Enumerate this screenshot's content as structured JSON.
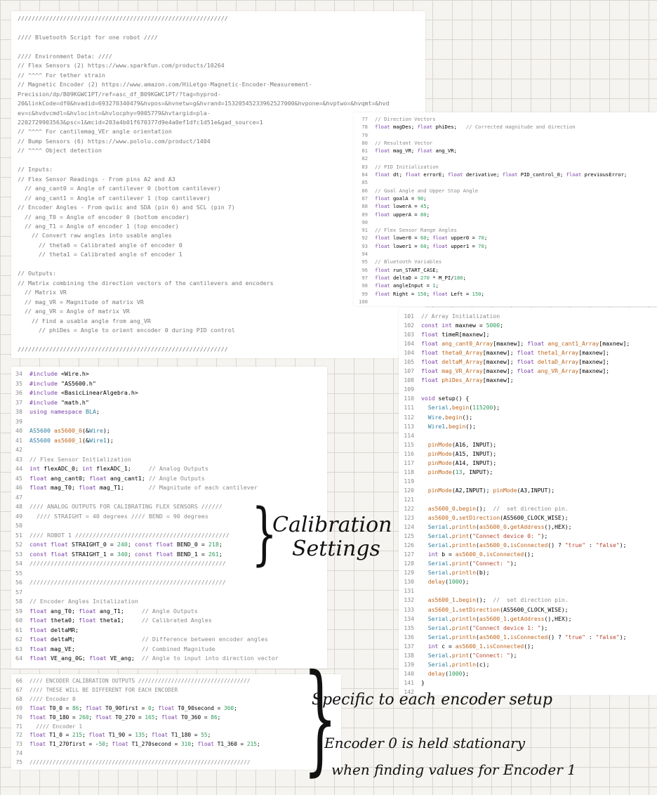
{
  "header_panel": {
    "lines": [
      "////////////////////////////////////////////////////////////",
      "",
      "//// Bluetooth Script for one robot ////",
      "",
      "//// Environment Data: ////",
      "// Flex Sensors (2) https://www.sparkfun.com/products/10264",
      "// ^^^^ For tether strain",
      "// Magnetic Encoder (2) https://www.amazon.com/HiLetgo-Magnetic-Encoder-Measurement-",
      "Precision/dp/B09KGWC1PT/ref=asc_df_B09KGWC1PT/?tag=hyprod-",
      "20&linkCode=df0&hvadid=693270340479&hvpos=&hvnetw=g&hvrand=15320545233962527000&hvpone=&hvptwo=&hvqmt=&hvd",
      "ev=c&hvdvcmdl=&hvlocint=&hvlocphy=9005779&hvtargid=pla-",
      "2202729903563&psc=1&mcid=203a4b01f670377d9e4a0ef1dfc1d51e&gad_source=1",
      "// ^^^^ For cantilemag_VEr angle orientation",
      "// Bump Sensors (6) https://www.pololu.com/product/1404",
      "// ^^^^ Object detection",
      "",
      "// Inputs:",
      "// Flex Sensor Readings - From pins A2 and A3",
      "  // ang_cant0 = Angle of cantilever 0 (bottom cantilever)",
      "  // ang_cant1 = Angle of cantilever 1 (top cantilever)",
      "// Encoder Angles - From qwiic and SDA (pin 6) and SCL (pin 7)",
      "  // ang_T0 = Angle of encoder 0 (bottom encoder)",
      "  // ang_T1 = Angle of encoder 1 (top encoder)",
      "    // Convert raw angles into usable angles",
      "      // theta0 = Calibrated angle of encoder 0",
      "      // theta1 = Calibrated angle of encoder 1",
      "",
      "// Outputs:",
      "// Matrix combining the direction vectors of the cantilevers and encoders",
      "  // Matrix VR",
      "  // mag_VR = Magnitude of matrix VR",
      "  // ang_VR = Angle of matrix VR",
      "    // Find a usable angle from ang_VR",
      "      // phiDes = Angle to orient encoder 0 during PID control",
      "",
      "////////////////////////////////////////////////////////////"
    ]
  },
  "panel_a": {
    "lines": [
      {
        "n": "77",
        "t": "// Direction Vectors"
      },
      {
        "n": "78",
        "t": "float magDes; float phiDes;   // Corrected magnitude and direction"
      },
      {
        "n": "79",
        "t": ""
      },
      {
        "n": "80",
        "t": "// Resultant Vector"
      },
      {
        "n": "81",
        "t": "float mag_VR; float ang_VR;"
      },
      {
        "n": "82",
        "t": ""
      },
      {
        "n": "83",
        "t": "// PID Initialization"
      },
      {
        "n": "84",
        "t": "float dt; float errorE; float derivative; float PID_control_0; float previousError;"
      },
      {
        "n": "85",
        "t": ""
      },
      {
        "n": "86",
        "t": "// Goal Angle and Upper Stop Angle"
      },
      {
        "n": "87",
        "t": "float goalA = 90;"
      },
      {
        "n": "88",
        "t": "float lowerA = 45;"
      },
      {
        "n": "89",
        "t": "float upperA = 80;"
      },
      {
        "n": "90",
        "t": ""
      },
      {
        "n": "91",
        "t": "// Flex Sensor Range Angles"
      },
      {
        "n": "92",
        "t": "float lower0 = 60; float upper0 = 70;"
      },
      {
        "n": "93",
        "t": "float lower1 = 60; float upper1 = 70;"
      },
      {
        "n": "94",
        "t": ""
      },
      {
        "n": "95",
        "t": "// Bluetooth Variables"
      },
      {
        "n": "96",
        "t": "float run_START_CASE;"
      },
      {
        "n": "97",
        "t": "float deltaD = 270 * M_PI/180;"
      },
      {
        "n": "98",
        "t": "float angleInput = 1;"
      },
      {
        "n": "99",
        "t": "float Right = 150; float Left = 150;"
      },
      {
        "n": "100",
        "t": ""
      }
    ]
  },
  "panel_b": {
    "lines": [
      {
        "n": "101",
        "t": "// Array Initialization"
      },
      {
        "n": "102",
        "t": "const int maxnew = 5000;"
      },
      {
        "n": "103",
        "t": "float timeR[maxnew];"
      },
      {
        "n": "104",
        "t": "float ang_cant0_Array[maxnew]; float ang_cant1_Array[maxnew];"
      },
      {
        "n": "104",
        "t": "float theta0_Array[maxnew]; float theta1_Array[maxnew];"
      },
      {
        "n": "105",
        "t": "float deltaM_Array[maxnew]; float deltaD_Array[maxnew];"
      },
      {
        "n": "107",
        "t": "float mag_VR_Array[maxnew]; float ang_VR_Array[maxnew];"
      },
      {
        "n": "108",
        "t": "float phiDes_Array[maxnew];"
      },
      {
        "n": "109",
        "t": ""
      },
      {
        "n": "110",
        "t": "void setup() {"
      },
      {
        "n": "111",
        "t": "  Serial.begin(115200);"
      },
      {
        "n": "112",
        "t": "  Wire.begin();"
      },
      {
        "n": "113",
        "t": "  Wire1.begin();"
      },
      {
        "n": "114",
        "t": ""
      },
      {
        "n": "115",
        "t": "  pinMode(A16, INPUT);"
      },
      {
        "n": "116",
        "t": "  pinMode(A15, INPUT);"
      },
      {
        "n": "117",
        "t": "  pinMode(A14, INPUT);"
      },
      {
        "n": "118",
        "t": "  pinMode(13, INPUT);"
      },
      {
        "n": "119",
        "t": ""
      },
      {
        "n": "120",
        "t": "  pinMode(A2,INPUT); pinMode(A3,INPUT);"
      },
      {
        "n": "121",
        "t": ""
      },
      {
        "n": "122",
        "t": "  as5600_0.begin();  //  set direction pin."
      },
      {
        "n": "123",
        "t": "  as5600_0.setDirection(AS5600_CLOCK_WISE);"
      },
      {
        "n": "124",
        "t": "  Serial.println(as5600_0.getAddress(),HEX);"
      },
      {
        "n": "125",
        "t": "  Serial.print(\"Connect device 0: \");"
      },
      {
        "n": "126",
        "t": "  Serial.println(as5600_0.isConnected() ? \"true\" : \"false\");"
      },
      {
        "n": "127",
        "t": "  int b = as5600_0.isConnected();"
      },
      {
        "n": "128",
        "t": "  Serial.print(\"Connect: \");"
      },
      {
        "n": "129",
        "t": "  Serial.println(b);"
      },
      {
        "n": "130",
        "t": "  delay(1000);"
      },
      {
        "n": "131",
        "t": ""
      },
      {
        "n": "132",
        "t": "  as5600_1.begin();  //  set direction pin."
      },
      {
        "n": "133",
        "t": "  as5600_1.setDirection(AS5600_CLOCK_WISE);"
      },
      {
        "n": "134",
        "t": "  Serial.println(as5600_1.getAddress(),HEX);"
      },
      {
        "n": "135",
        "t": "  Serial.print(\"Connect device 1: \");"
      },
      {
        "n": "136",
        "t": "  Serial.println(as5600_1.isConnected() ? \"true\" : \"false\");"
      },
      {
        "n": "137",
        "t": "  int c = as5600_1.isConnected();"
      },
      {
        "n": "138",
        "t": "  Serial.print(\"Connect: \");"
      },
      {
        "n": "139",
        "t": "  Serial.println(c);"
      },
      {
        "n": "140",
        "t": "  delay(1000);"
      },
      {
        "n": "141",
        "t": "}"
      },
      {
        "n": "142",
        "t": ""
      }
    ]
  },
  "panel_c": {
    "lines": [
      {
        "n": "34",
        "t": "#include <Wire.h>"
      },
      {
        "n": "35",
        "t": "#include \"AS5600.h\""
      },
      {
        "n": "36",
        "t": "#include <BasicLinearAlgebra.h>"
      },
      {
        "n": "37",
        "t": "#include \"math.h\""
      },
      {
        "n": "38",
        "t": "using namespace BLA;"
      },
      {
        "n": "39",
        "t": ""
      },
      {
        "n": "40",
        "t": "AS5600 as5600_0(&Wire);"
      },
      {
        "n": "41",
        "t": "AS5600 as5600_1(&Wire1);"
      },
      {
        "n": "42",
        "t": ""
      },
      {
        "n": "43",
        "t": "// Flex Sensor Initialization"
      },
      {
        "n": "44",
        "t": "int flexADC_0; int flexADC_1;     // Analog Outputs"
      },
      {
        "n": "45",
        "t": "float ang_cant0; float ang_cant1; // Angle Outputs"
      },
      {
        "n": "46",
        "t": "float mag_T0; float mag_T1;       // Magnitude of each cantilever"
      },
      {
        "n": "47",
        "t": ""
      },
      {
        "n": "48",
        "t": "//// ANALOG OUTPUTS FOR CALIBRATING FLEX SENSORS //////"
      },
      {
        "n": "49",
        "t": "  //// STRAIGHT = 40 degrees //// BEND = 90 degrees"
      },
      {
        "n": "50",
        "t": ""
      },
      {
        "n": "51",
        "t": "//// ROBOT 1 ////////////////////////////////////////////"
      },
      {
        "n": "52",
        "t": "const float STRAIGHT_0 = 240; const float BEND_0 = 218;"
      },
      {
        "n": "53",
        "t": "const float STRAIGHT_1 = 340; const float BEND_1 = 261;"
      },
      {
        "n": "54",
        "t": "////////////////////////////////////////////////////////"
      },
      {
        "n": "55",
        "t": ""
      },
      {
        "n": "56",
        "t": "////////////////////////////////////////////////////////"
      },
      {
        "n": "57",
        "t": ""
      },
      {
        "n": "58",
        "t": "// Encoder Angles Initalization"
      },
      {
        "n": "59",
        "t": "float ang_T0; float ang_T1;     // Angle Outputs"
      },
      {
        "n": "60",
        "t": "float theta0; float theta1;     // Calibrated Angles"
      },
      {
        "n": "61",
        "t": "float deltaMR;"
      },
      {
        "n": "62",
        "t": "float deltaM;                   // Difference between encoder angles"
      },
      {
        "n": "63",
        "t": "float mag_VE;                   // Combined Magnitude"
      },
      {
        "n": "64",
        "t": "float VE_ang_0G; float VE_ang;  // Angle to input into direction vector"
      }
    ]
  },
  "panel_d": {
    "lines": [
      {
        "n": "66",
        "t": "//// ENCODER CALIBRATION OUTPUTS //////////////////////////////////"
      },
      {
        "n": "67",
        "t": "//// THESE WILL BE DIFFERENT FOR EACH ENCODER"
      },
      {
        "n": "68",
        "t": "//// Encoder 0"
      },
      {
        "n": "69",
        "t": "float T0_0 = 86; float T0_90first = 0; float T0_90second = 360;"
      },
      {
        "n": "70",
        "t": "float T0_180 = 260; float T0_270 = 165; float T0_360 = 86;"
      },
      {
        "n": "71",
        "t": "  //// Encoder 1"
      },
      {
        "n": "72",
        "t": "float T1_0 = 215; float T1_90 = 135; float T1_180 = 55;"
      },
      {
        "n": "73",
        "t": "float T1_270first = -50; float T1_270second = 310; float T1_360 = 215;"
      },
      {
        "n": "74",
        "t": ""
      },
      {
        "n": "75",
        "t": "///////////////////////////////////////////////////////////////////"
      }
    ]
  },
  "annotations": {
    "calibration_1": "Calibration",
    "calibration_2": "Settings",
    "specific": "Specific to each encoder setup",
    "encoder0_1": "Encoder 0 is held stationary",
    "encoder0_2": "when finding values for Encoder 1"
  },
  "colors": {
    "keyword": "#7a3fa6",
    "type": "#2f7fa0",
    "function": "#c0651b",
    "number": "#2c9a5b",
    "string": "#b7462e",
    "comment": "#8a8a8a"
  }
}
